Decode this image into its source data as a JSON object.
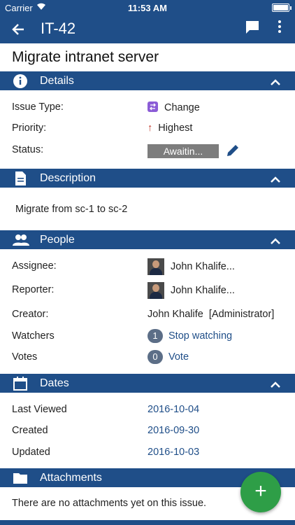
{
  "status_bar": {
    "carrier": "Carrier",
    "time": "11:53 AM"
  },
  "app_bar": {
    "issue_key": "IT-42"
  },
  "issue_title": "Migrate intranet server",
  "details": {
    "header": "Details",
    "issue_type_label": "Issue Type:",
    "issue_type_value": "Change",
    "priority_label": "Priority:",
    "priority_value": "Highest",
    "status_label": "Status:",
    "status_value": "Awaitin..."
  },
  "description": {
    "header": "Description",
    "text": "Migrate from sc-1 to sc-2"
  },
  "people": {
    "header": "People",
    "assignee_label": "Assignee:",
    "assignee_value": "John Khalife...",
    "reporter_label": "Reporter:",
    "reporter_value": "John Khalife...",
    "creator_label": "Creator:",
    "creator_value": "John Khalife  [Administrator]",
    "watchers_label": "Watchers",
    "watchers_count": "1",
    "watchers_action": "Stop watching",
    "votes_label": "Votes",
    "votes_count": "0",
    "votes_action": "Vote"
  },
  "dates": {
    "header": "Dates",
    "last_viewed_label": "Last Viewed",
    "last_viewed_value": "2016-10-04",
    "created_label": "Created",
    "created_value": "2016-09-30",
    "updated_label": "Updated",
    "updated_value": "2016-10-03"
  },
  "attachments": {
    "header": "Attachments",
    "empty_text": "There are no attachments yet on this issue."
  },
  "fab": {
    "label": "+"
  },
  "colors": {
    "primary": "#1f4e88",
    "fab": "#2e9e47",
    "status_bg": "#7d7d7d",
    "change_icon": "#8b5cd6",
    "priority_highest": "#c0392b"
  }
}
